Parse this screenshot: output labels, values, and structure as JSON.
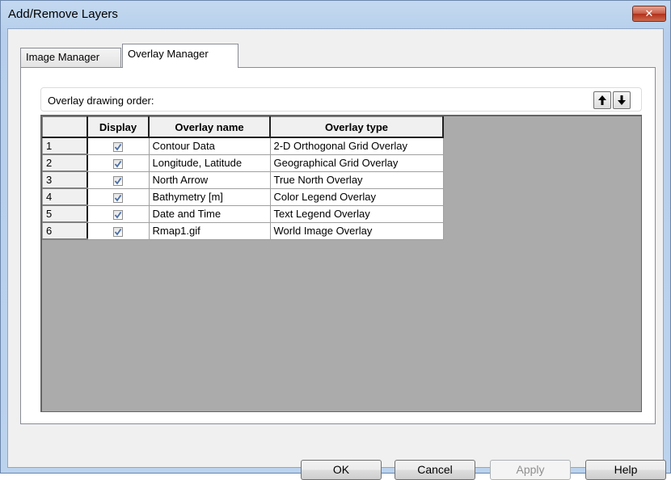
{
  "window": {
    "title": "Add/Remove Layers",
    "close_label": "✕"
  },
  "tabs": [
    {
      "label": "Image Manager",
      "active": false
    },
    {
      "label": "Overlay Manager",
      "active": true
    }
  ],
  "overlay": {
    "order_label": "Overlay drawing order:",
    "columns": [
      "",
      "Display",
      "Overlay name",
      "Overlay type"
    ],
    "rows": [
      {
        "num": "1",
        "display": true,
        "name": "Contour Data",
        "type": "2-D Orthogonal Grid Overlay"
      },
      {
        "num": "2",
        "display": true,
        "name": "Longitude, Latitude",
        "type": "Geographical Grid Overlay"
      },
      {
        "num": "3",
        "display": true,
        "name": "North Arrow",
        "type": "True North Overlay"
      },
      {
        "num": "4",
        "display": true,
        "name": "Bathymetry [m]",
        "type": "Color Legend Overlay"
      },
      {
        "num": "5",
        "display": true,
        "name": "Date and Time",
        "type": "Text Legend Overlay"
      },
      {
        "num": "6",
        "display": true,
        "name": "Rmap1.gif",
        "type": "World Image Overlay"
      }
    ]
  },
  "buttons": {
    "ok": "OK",
    "cancel": "Cancel",
    "apply": "Apply",
    "help": "Help"
  },
  "icons": {
    "move_up": "arrow-up-icon",
    "move_down": "arrow-down-icon",
    "close": "close-icon"
  }
}
